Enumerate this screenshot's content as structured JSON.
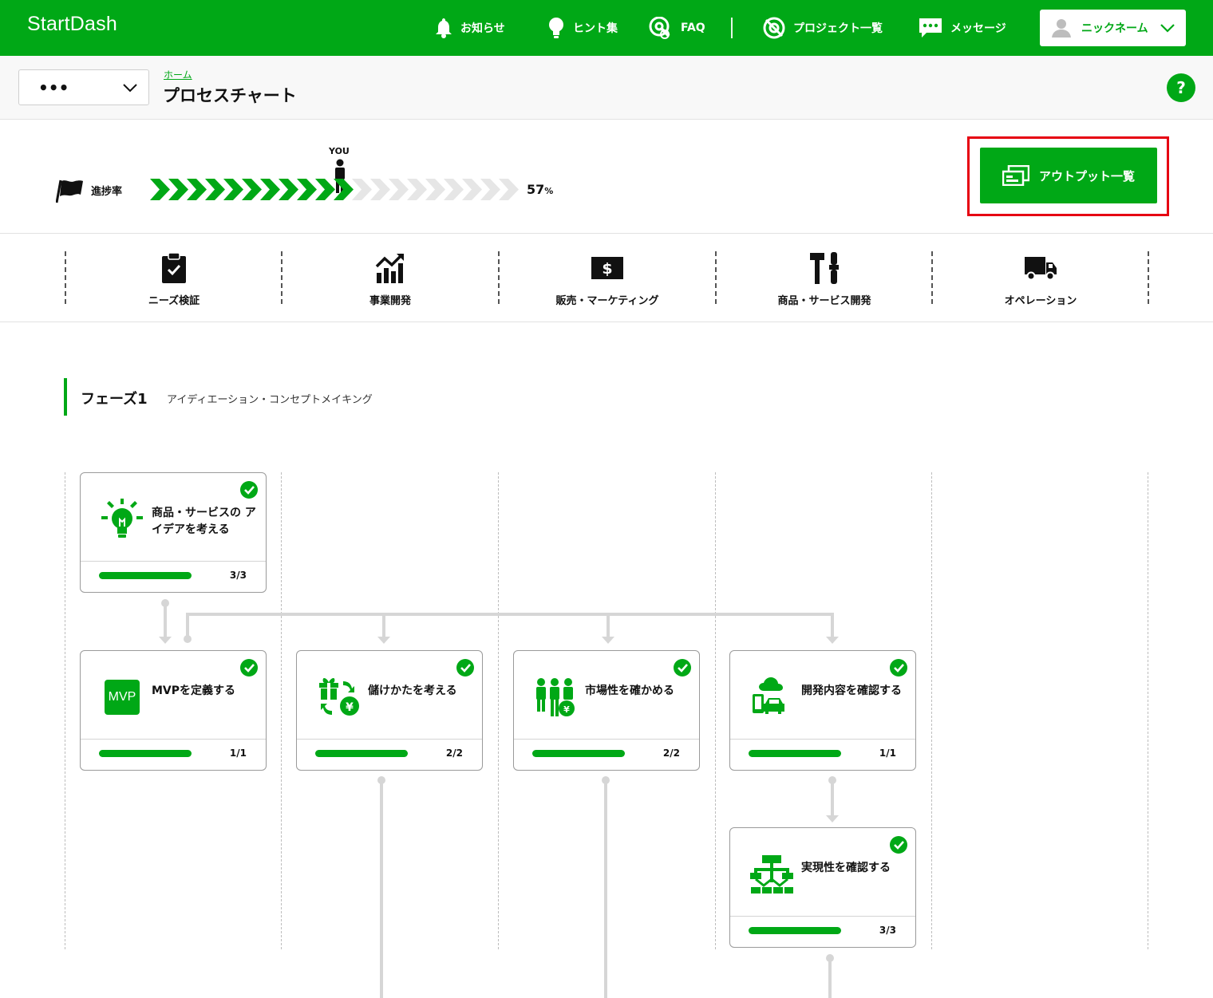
{
  "app": {
    "logo": "StartDash"
  },
  "nav": {
    "notice": "お知らせ",
    "hints": "ヒント集",
    "faq": "FAQ",
    "projects": "プロジェクト一覧",
    "messages": "メッセージ",
    "user": "ニックネーム"
  },
  "subheader": {
    "dropdown": "•••",
    "breadcrumb": "ホーム",
    "title": "プロセスチャート",
    "help": "?"
  },
  "progress": {
    "label": "進捗率",
    "marker": "YOU",
    "value": 57,
    "unit": "%",
    "chevrons_total": 20,
    "chevrons_done": 11
  },
  "output_button": {
    "label": "アウトプット一覧"
  },
  "categories": [
    {
      "label": "ニーズ検証",
      "icon": "clipboard-check-icon"
    },
    {
      "label": "事業開発",
      "icon": "chart-growth-icon"
    },
    {
      "label": "販売・マーケティング",
      "icon": "dollar-bill-icon"
    },
    {
      "label": "商品・サービス開発",
      "icon": "tools-icon"
    },
    {
      "label": "オペレーション",
      "icon": "truck-icon"
    }
  ],
  "phase": {
    "title": "フェーズ1",
    "subtitle": "アイディエーション・コンセプトメイキング"
  },
  "cards": [
    {
      "title": "商品・サービスの アイデアを考える",
      "count": "3/3",
      "done": 3,
      "total": 3,
      "icon": "lightbulb-icon"
    },
    {
      "title": "MVPを定義する",
      "count": "1/1",
      "done": 1,
      "total": 1,
      "icon": "mvp-icon",
      "icon_text": "MVP"
    },
    {
      "title": "儲けかたを考える",
      "count": "2/2",
      "done": 2,
      "total": 2,
      "icon": "gift-yen-cycle-icon"
    },
    {
      "title": "市場性を確かめる",
      "count": "2/2",
      "done": 2,
      "total": 2,
      "icon": "people-market-icon"
    },
    {
      "title": "開発内容を確認する",
      "count": "1/1",
      "done": 1,
      "total": 1,
      "icon": "cloud-device-car-icon"
    },
    {
      "title": "実現性を確認する",
      "count": "3/3",
      "done": 3,
      "total": 3,
      "icon": "flowchart-icon"
    }
  ],
  "colors": {
    "brand": "#00a816",
    "highlight": "#e60012",
    "pending": "#e6e6e6"
  }
}
